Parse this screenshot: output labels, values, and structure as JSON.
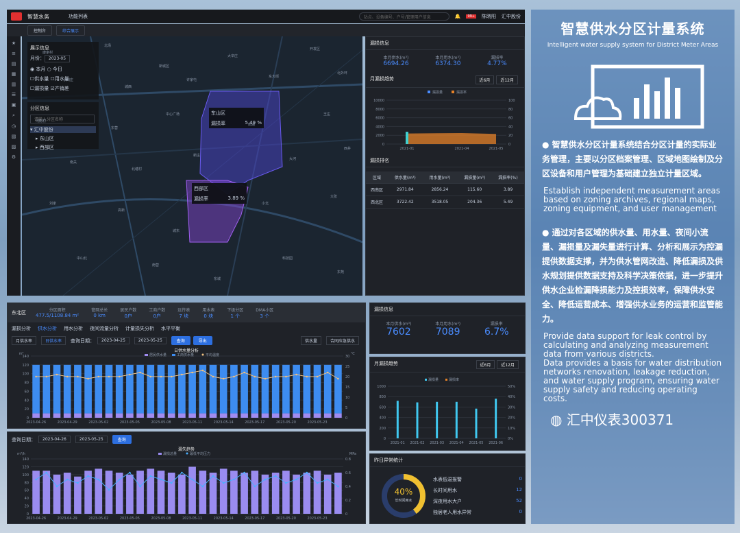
{
  "app": {
    "title": "智慧水务",
    "menu": "功能列表",
    "search_placeholder": "站点、设备编号、户号/管理用户信息",
    "user": "陈晓阳",
    "right": "汇中股份",
    "badge": "99+"
  },
  "tabs": [
    {
      "label": "控制台"
    },
    {
      "label": "综合展示"
    }
  ],
  "layer": {
    "title": "展示信息",
    "month_label": "月份：",
    "month": "2023-05",
    "rb1": "本月",
    "rb2": "今日",
    "cb": [
      "供水量",
      "用水量",
      "漏损量",
      "产销差"
    ]
  },
  "tree": {
    "title": "分区信息",
    "search": "请输入分区名称",
    "root": "汇中股份",
    "n1": "东山区",
    "n2": "西部区"
  },
  "popups": [
    {
      "name": "东山区",
      "label": "漏损率",
      "value": "5.49 %"
    },
    {
      "name": "西部区",
      "label": "漏损率",
      "value": "3.89 %"
    }
  ],
  "places": [
    "康家村",
    "北场",
    "新城区",
    "大辛庄",
    "开发区",
    "小刘庄",
    "城西",
    "许家屯",
    "东大街",
    "北外环",
    "河南村",
    "东营",
    "中心广场",
    "南湖",
    "王庄",
    "南关",
    "北塘村",
    "新庄",
    "大河",
    "西井",
    "刘家",
    "高新",
    "城东",
    "小北",
    "大张",
    "中山北",
    "南营",
    "东城",
    "科技园",
    "东苑"
  ],
  "leak_info": {
    "title": "漏损信息",
    "c1": "本月供水(m³)",
    "v1": "6694.26",
    "c2": "本月用水(m³)",
    "v2": "6374.30",
    "c3": "漏损率",
    "v3": "4.77%"
  },
  "month_trend": {
    "title": "月漏损趋势",
    "b1": "近6月",
    "b2": "近12月",
    "l1": "漏损量",
    "l2": "漏损率",
    "yl": "m³",
    "yr": "%"
  },
  "rank": {
    "title": "漏损排名",
    "cols": [
      "区域",
      "供水量(m³)",
      "用水量(m³)",
      "漏损量(m³)",
      "漏损率(%)"
    ],
    "rows": [
      [
        "西南区",
        "2971.84",
        "2856.24",
        "115.60",
        "3.89"
      ],
      [
        "西北区",
        "3722.42",
        "3518.05",
        "204.36",
        "5.49"
      ]
    ]
  },
  "area": {
    "name": "东北区",
    "items": [
      {
        "c": "分区面积",
        "v": "477.5/1108.84 m²"
      },
      {
        "c": "管网总长",
        "v": "0 km"
      },
      {
        "c": "居民户数",
        "v": "0户"
      },
      {
        "c": "工商户数",
        "v": "0户"
      },
      {
        "c": "远传表",
        "v": "7 块"
      },
      {
        "c": "用水表",
        "v": "0 块"
      },
      {
        "c": "下级分区",
        "v": "1 个"
      },
      {
        "c": "DMA小区",
        "v": "3 个"
      }
    ]
  },
  "subtabs": [
    "漏损分析",
    "供水分析",
    "用水分析",
    "夜间流量分析",
    "计量损失分析",
    "水平平衡"
  ],
  "query1": {
    "t1": "月供水率",
    "t2": "日供水率",
    "label": "查询日期：",
    "from": "2023-04-25",
    "to": "2023-05-25",
    "btn1": "查询",
    "btn2": "导出",
    "g1": "供水量",
    "g2": "合同应急供水"
  },
  "query2": {
    "label": "查询日期：",
    "from": "2023-04-26",
    "to": "2023-05-25",
    "btn": "查询"
  },
  "stats2": {
    "title": "漏损信息",
    "c1": "本月供水(m³)",
    "v1": "7602",
    "c2": "本月用水(m³)",
    "v2": "7089",
    "c3": "漏损率",
    "v3": "6.7%"
  },
  "trend2": {
    "title": "月漏损趋势",
    "b1": "近6月",
    "b2": "近12月",
    "l1": "漏损量",
    "l2": "漏损率"
  },
  "abn": {
    "title": "昨日异常统计",
    "pct": "40%",
    "pct_label": "长时间用水",
    "items": [
      {
        "c": "水表低温报警",
        "v": "0"
      },
      {
        "c": "长时间用水",
        "v": "12"
      },
      {
        "c": "深夜用水大户",
        "v": "52"
      },
      {
        "c": "独居老人用水异常",
        "v": "0"
      }
    ]
  },
  "promo": {
    "title": "智慧供水分区计量系统",
    "subtitle": "Intelligent water supply system for District Meter Areas",
    "p1": "● 智慧供水分区计量系统结合分区计量的实际业务管理，主要以分区档案管理、区域地图绘制及分区设备和用户管理为基础建立独立计量区域。",
    "e1": "Establish independent measurement areas based on zoning archives, regional maps, zoning equipment, and user management",
    "p2": "● 通过对各区域的供水量、用水量、夜间小流量、漏损量及漏失量进行计算、分析和展示为控漏提供数据支撑，并为供水管网改造、降低漏损及供水规划提供数据支持及科学决策依据，进一步提升供水企业检漏降损能力及控损效率，保障供水安全、降低运营成本、增强供水业务的运营和监管能力。",
    "e2": "Provide data support for leak control by calculating and analyzing measurement data from various districts.",
    "e3": "Data provides a basis for water distribution networks renovation, leakage reduction, and water supply program, ensuring water supply safety and reducing operating costs.",
    "brand": "汇中仪表300371"
  },
  "chart_data": [
    {
      "type": "area",
      "title": "",
      "x": [
        "2021-01",
        "2021-04",
        "2021-05"
      ],
      "series": [
        {
          "name": "漏损量",
          "values": [
            2400,
            2500,
            2300
          ]
        },
        {
          "name": "漏损率",
          "values": [
            28,
            30,
            26
          ]
        }
      ],
      "ylim": [
        0,
        10000
      ],
      "y2lim": [
        0,
        100
      ]
    },
    {
      "type": "bar",
      "title": "日供水量分析",
      "xlabel": "",
      "ylabel": "m³",
      "y2label": "℃",
      "ylim": [
        0,
        140
      ],
      "y2lim": [
        0,
        30
      ],
      "categories": [
        "2023-04-26",
        "2023-04-27",
        "2023-04-28",
        "2023-04-29",
        "2023-04-30",
        "2023-05-01",
        "2023-05-02",
        "2023-05-03",
        "2023-05-04",
        "2023-05-05",
        "2023-05-06",
        "2023-05-07",
        "2023-05-08",
        "2023-05-09",
        "2023-05-10",
        "2023-05-11",
        "2023-05-12",
        "2023-05-13",
        "2023-05-14",
        "2023-05-15",
        "2023-05-16",
        "2023-05-17",
        "2023-05-18",
        "2023-05-19",
        "2023-05-20",
        "2023-05-21",
        "2023-05-22",
        "2023-05-23",
        "2023-05-24",
        "2023-05-25"
      ],
      "series": [
        {
          "name": "居民供水量",
          "values": [
            10,
            10,
            10,
            10,
            10,
            10,
            10,
            10,
            10,
            10,
            10,
            10,
            10,
            10,
            10,
            10,
            10,
            10,
            10,
            10,
            10,
            10,
            10,
            10,
            10,
            10,
            10,
            10,
            10,
            10
          ]
        },
        {
          "name": "工商供水量",
          "values": [
            110,
            110,
            110,
            110,
            110,
            110,
            110,
            110,
            110,
            110,
            110,
            110,
            110,
            110,
            110,
            110,
            110,
            110,
            110,
            110,
            110,
            110,
            110,
            110,
            110,
            110,
            110,
            110,
            110,
            110
          ]
        },
        {
          "name": "平均温度",
          "values": [
            20,
            20,
            21,
            20,
            20,
            19,
            20,
            20,
            20,
            21,
            22,
            20,
            20,
            20,
            21,
            22,
            23,
            20,
            19,
            20,
            22,
            20,
            19,
            20,
            20,
            21,
            20,
            20,
            22,
            19
          ]
        }
      ],
      "ticks": [
        "2023-04-26",
        "2023-04-29",
        "2023-05-02",
        "2023-05-05",
        "2023-05-08",
        "2023-05-11",
        "2023-05-14",
        "2023-05-17",
        "2023-05-20",
        "2023-05-23"
      ]
    },
    {
      "type": "bar",
      "title": "漏失趋势",
      "ylabel": "m³/h",
      "y2label": "MPa",
      "ylim": [
        0,
        140
      ],
      "y2lim": [
        0,
        0.8
      ],
      "categories": [
        "2023-04-26",
        "2023-04-27",
        "2023-04-28",
        "2023-04-29",
        "2023-04-30",
        "2023-05-01",
        "2023-05-02",
        "2023-05-03",
        "2023-05-04",
        "2023-05-05",
        "2023-05-06",
        "2023-05-07",
        "2023-05-08",
        "2023-05-09",
        "2023-05-10",
        "2023-05-11",
        "2023-05-12",
        "2023-05-13",
        "2023-05-14",
        "2023-05-15",
        "2023-05-16",
        "2023-05-17",
        "2023-05-18",
        "2023-05-19",
        "2023-05-20",
        "2023-05-21",
        "2023-05-22",
        "2023-05-23",
        "2023-05-24",
        "2023-05-25"
      ],
      "series": [
        {
          "name": "漏损总量",
          "values": [
            110,
            110,
            100,
            105,
            95,
            110,
            115,
            110,
            105,
            100,
            110,
            115,
            110,
            105,
            100,
            120,
            110,
            105,
            115,
            110,
            105,
            110,
            100,
            105,
            110,
            100,
            105,
            110,
            100,
            105
          ]
        },
        {
          "name": "最低平均压力",
          "values": [
            0.5,
            0.6,
            0.4,
            0.5,
            0.45,
            0.55,
            0.5,
            0.35,
            0.5,
            0.6,
            0.4,
            0.55,
            0.5,
            0.45,
            0.6,
            0.5,
            0.4,
            0.55,
            0.45,
            0.5,
            0.6,
            0.4,
            0.5,
            0.55,
            0.45,
            0.5,
            0.6,
            0.45,
            0.5,
            0.4
          ]
        }
      ],
      "ticks": [
        "2023-04-26",
        "2023-04-29",
        "2023-05-02",
        "2023-05-05",
        "2023-05-08",
        "2023-05-11",
        "2023-05-14",
        "2023-05-17",
        "2023-05-20",
        "2023-05-23"
      ]
    },
    {
      "type": "bar",
      "title": "月漏损趋势",
      "ylim": [
        0,
        1000
      ],
      "y2lim": [
        0,
        50
      ],
      "categories": [
        "2021-01",
        "2021-02",
        "2021-03",
        "2021-04",
        "2021-05",
        "2021-06"
      ],
      "series": [
        {
          "name": "漏损量",
          "values": [
            720,
            690,
            700,
            700,
            570,
            760
          ]
        },
        {
          "name": "漏损率",
          "values": [
            0,
            0,
            0,
            0,
            0,
            0
          ]
        }
      ]
    }
  ]
}
